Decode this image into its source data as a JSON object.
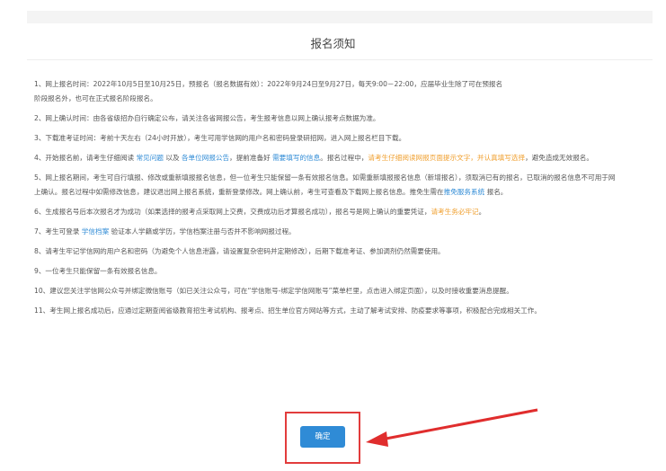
{
  "page": {
    "title": "报名须知"
  },
  "notices": [
    {
      "segments": [
        {
          "text": "1、网上报名时间：2022年10月5日至10月25日，预报名（报名数据有效）：2022年9月24日至9月27日，每天9:00－22:00，应届毕业生除了可在预报名",
          "style": "normal"
        },
        {
          "text": "阶段报名外，也可在正式报名阶段报名。",
          "style": "normal"
        }
      ]
    },
    {
      "segments": [
        {
          "text": "2、网上确认时间：由各省级招办自行确定公布，请关注各省网报公告，考生报考信息以网上确认报考点数据为准。",
          "style": "normal"
        }
      ]
    },
    {
      "segments": [
        {
          "text": "3、下载准考证时间：考前十天左右（24小时开放），考生可用学信网的用户名和密码登录研招网，进入网上报名栏目下载。",
          "style": "normal"
        }
      ]
    },
    {
      "segments": [
        {
          "text": "4、开始报名前，请考生仔细阅读 ",
          "style": "normal"
        },
        {
          "text": "常见问题",
          "style": "link"
        },
        {
          "text": " 以及 ",
          "style": "normal"
        },
        {
          "text": "各单位网报公告",
          "style": "link"
        },
        {
          "text": "，提前准备好 ",
          "style": "normal"
        },
        {
          "text": "需要填写的信息",
          "style": "link"
        },
        {
          "text": "。报名过程中，",
          "style": "normal"
        },
        {
          "text": "请考生仔细阅读网报页面提示文字，并认真填写选择",
          "style": "warn"
        },
        {
          "text": "，避免造成无效报名。",
          "style": "normal"
        }
      ]
    },
    {
      "segments": [
        {
          "text": "5、网上报名期间，考生可自行填报、修改或重新填报报名信息，但一位考生只能保留一条有效报名信息。如需重新填报报名信息（新增报名），须取消已有的报名，已取消的报名信息不可用于网上确认。报名过程中如需修改信息，建议退出网上报名系统，重新登录修改。网上确认前，考生可查看及下载网上报名信息。推免生需在",
          "style": "normal"
        },
        {
          "text": "推免服务系统",
          "style": "link"
        },
        {
          "text": " 报名。",
          "style": "normal"
        }
      ]
    },
    {
      "segments": [
        {
          "text": "6、生成报名号后本次报名才为成功（如果选择的报考点采取网上交费，交费成功后才算报名成功），报名号是网上确认的重要凭证，",
          "style": "normal"
        },
        {
          "text": "请考生务必牢记",
          "style": "warn"
        },
        {
          "text": "。",
          "style": "normal"
        }
      ]
    },
    {
      "segments": [
        {
          "text": "7、考生可登录 ",
          "style": "normal"
        },
        {
          "text": "学信档案",
          "style": "link"
        },
        {
          "text": " 验证本人学籍或学历，学信档案注册与否并不影响网报过程。",
          "style": "normal"
        }
      ]
    },
    {
      "segments": [
        {
          "text": "8、请考生牢记学信网的用户名和密码（为避免个人信息泄露，请设置复杂密码并定期修改），后期下载准考证、参加调剂仍然需要使用。",
          "style": "normal"
        }
      ]
    },
    {
      "segments": [
        {
          "text": "9、一位考生只能保留一条有效报名信息。",
          "style": "normal"
        }
      ]
    },
    {
      "segments": [
        {
          "text": "10、建议您关注学信网公众号并绑定微信账号（如已关注公众号，可在“学信账号-绑定学信网账号”菜单栏里，点击进入绑定页面），以及时接收重要消息提醒。",
          "style": "normal"
        }
      ]
    },
    {
      "segments": [
        {
          "text": "11、考生网上报名成功后，应通过定期查阅省级教育招生考试机构、报考点、招生单位官方网站等方式，主动了解考试安排、防疫要求等事项，积极配合完成相关工作。",
          "style": "normal"
        }
      ]
    }
  ],
  "confirm_button": {
    "label": "确定"
  },
  "colors": {
    "link": "#2f8bd6",
    "warn": "#f0a030",
    "highlight_box": "#e23c3c",
    "arrow": "#e02d2d"
  }
}
